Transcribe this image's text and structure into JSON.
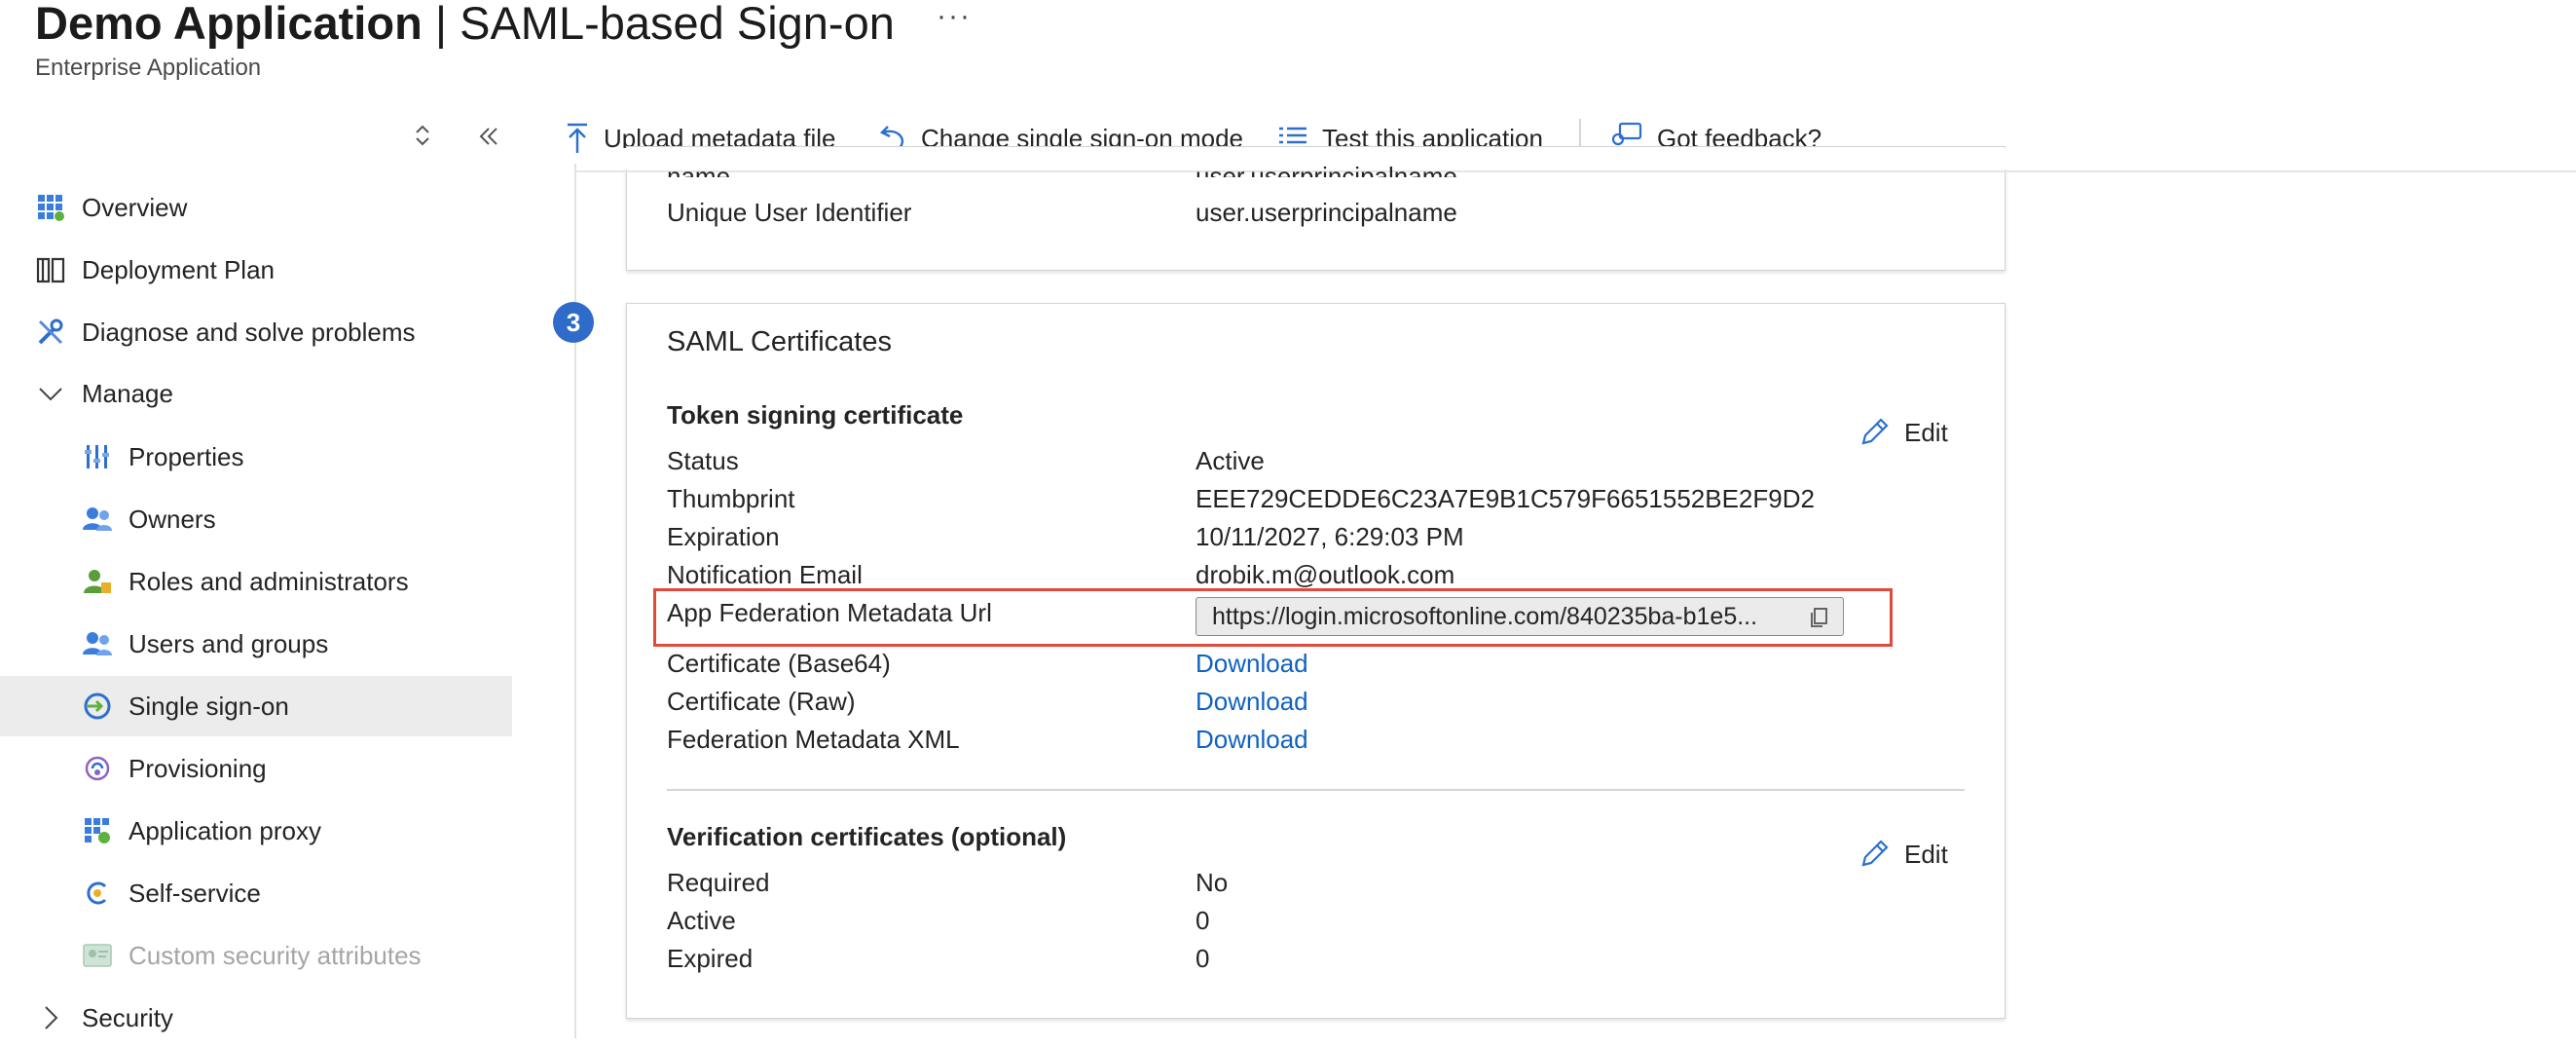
{
  "header": {
    "app_name": "Demo Application",
    "separator": " | ",
    "page_name": "SAML-based Sign-on",
    "more": "···",
    "subtitle": "Enterprise Application"
  },
  "toolbar": {
    "upload": "Upload metadata file",
    "change_mode": "Change single sign-on mode",
    "test": "Test this application",
    "feedback": "Got feedback?"
  },
  "sidebar": {
    "items": [
      {
        "label": "Overview",
        "icon": "overview-grid-icon"
      },
      {
        "label": "Deployment Plan",
        "icon": "book-icon"
      },
      {
        "label": "Diagnose and solve problems",
        "icon": "wrench-icon"
      },
      {
        "label": "Manage",
        "icon": "chevron-down-icon"
      },
      {
        "label": "Properties",
        "icon": "properties-icon"
      },
      {
        "label": "Owners",
        "icon": "owners-icon"
      },
      {
        "label": "Roles and administrators",
        "icon": "roles-icon"
      },
      {
        "label": "Users and groups",
        "icon": "users-groups-icon"
      },
      {
        "label": "Single sign-on",
        "icon": "sso-icon",
        "selected": true
      },
      {
        "label": "Provisioning",
        "icon": "provisioning-icon"
      },
      {
        "label": "Application proxy",
        "icon": "app-proxy-icon"
      },
      {
        "label": "Self-service",
        "icon": "self-service-icon"
      },
      {
        "label": "Custom security attributes",
        "icon": "security-attributes-icon",
        "disabled": true
      },
      {
        "label": "Security",
        "icon": "chevron-right-icon"
      }
    ]
  },
  "attributes_card": {
    "rows": [
      {
        "label": "name",
        "value": "user.userprincipalname"
      },
      {
        "label": "Unique User Identifier",
        "value": "user.userprincipalname"
      }
    ]
  },
  "certificates_card": {
    "step": "3",
    "title": "SAML Certificates",
    "token_signing": {
      "title": "Token signing certificate",
      "edit": "Edit",
      "rows": [
        {
          "label": "Status",
          "value": "Active"
        },
        {
          "label": "Thumbprint",
          "value": "EEE729CEDDE6C23A7E9B1C579F6651552BE2F9D2"
        },
        {
          "label": "Expiration",
          "value": "10/11/2027, 6:29:03 PM"
        },
        {
          "label": "Notification Email",
          "value": "drobik.m@outlook.com"
        }
      ],
      "metadata_url_label": "App Federation Metadata Url",
      "metadata_url_value": "https://login.microsoftonline.com/840235ba-b1e5...",
      "downloads": [
        {
          "label": "Certificate (Base64)",
          "value": "Download"
        },
        {
          "label": "Certificate (Raw)",
          "value": "Download"
        },
        {
          "label": "Federation Metadata XML",
          "value": "Download"
        }
      ]
    },
    "verification": {
      "title": "Verification certificates (optional)",
      "edit": "Edit",
      "rows": [
        {
          "label": "Required",
          "value": "No"
        },
        {
          "label": "Active",
          "value": "0"
        },
        {
          "label": "Expired",
          "value": "0"
        }
      ]
    }
  },
  "colors": {
    "accent": "#0f62c1",
    "highlight": "#e04a3a",
    "selected_bg": "#ececec",
    "badge": "#2f6bc9"
  }
}
